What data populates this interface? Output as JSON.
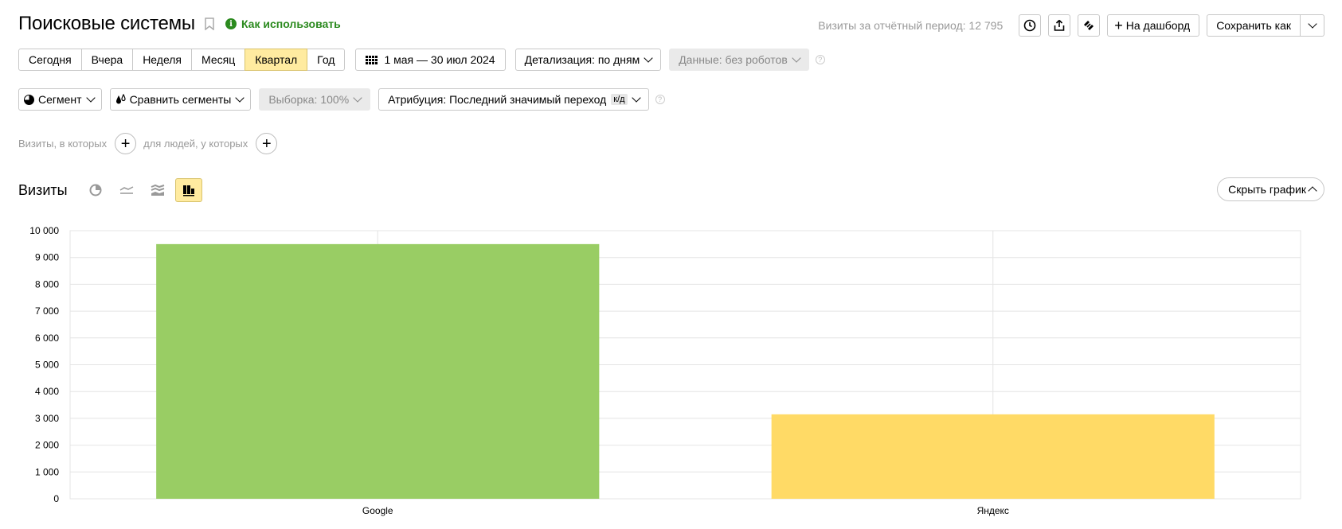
{
  "header": {
    "title": "Поисковые системы",
    "howto_label": "Как использовать",
    "visits_total": "Визиты за отчётный период: 12 795",
    "dashboard_label": "На дашборд",
    "save_as_label": "Сохранить как"
  },
  "period": {
    "options": [
      "Сегодня",
      "Вчера",
      "Неделя",
      "Месяц",
      "Квартал",
      "Год"
    ],
    "active": "Квартал",
    "date_range": "1 мая — 30 июл 2024",
    "detail_label": "Детализация: по дням",
    "data_label": "Данные: без роботов"
  },
  "segments": {
    "segment_label": "Сегмент",
    "compare_label": "Сравнить сегменты",
    "sample_label": "Выборка: 100%",
    "attribution_label": "Атрибуция: Последний значимый переход",
    "attribution_badge": "к/д"
  },
  "filters": {
    "visits_label": "Визиты, в которых",
    "people_label": "для людей, у которых"
  },
  "chart_header": {
    "title": "Визиты",
    "hide_label": "Скрыть график"
  },
  "chart_data": {
    "type": "bar",
    "categories": [
      "Google",
      "Яндекс"
    ],
    "values": [
      9500,
      3150
    ],
    "colors": [
      "#99cd64",
      "#ffda66"
    ],
    "ylim": [
      0,
      10000
    ],
    "yticks": [
      0,
      1000,
      2000,
      3000,
      4000,
      5000,
      6000,
      7000,
      8000,
      9000,
      10000
    ],
    "ytick_labels": [
      "0",
      "1 000",
      "2 000",
      "3 000",
      "4 000",
      "5 000",
      "6 000",
      "7 000",
      "8 000",
      "9 000",
      "10 000"
    ],
    "grid": true
  }
}
